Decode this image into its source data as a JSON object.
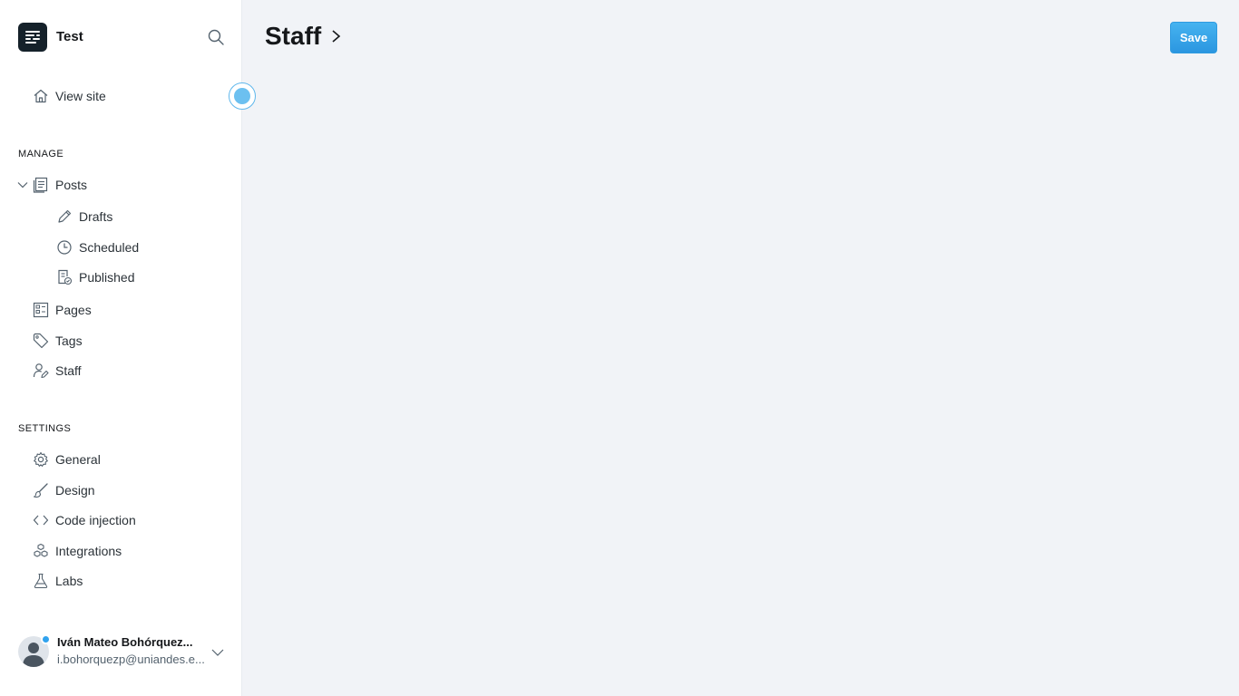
{
  "site": {
    "title": "Test"
  },
  "nav": {
    "view_site": "View site",
    "manage_title": "MANAGE",
    "posts": "Posts",
    "drafts": "Drafts",
    "scheduled": "Scheduled",
    "published": "Published",
    "pages": "Pages",
    "tags": "Tags",
    "staff": "Staff",
    "settings_title": "SETTINGS",
    "general": "General",
    "design": "Design",
    "code_injection": "Code injection",
    "integrations": "Integrations",
    "labs": "Labs"
  },
  "user": {
    "name": "Iván Mateo Bohórquez...",
    "email": "i.bohorquezp@uniandes.e..."
  },
  "header": {
    "title": "Staff",
    "save_label": "Save"
  },
  "colors": {
    "accent": "#30a2ee",
    "sidebar_bg": "#ffffff",
    "main_bg": "#f1f3f7"
  }
}
